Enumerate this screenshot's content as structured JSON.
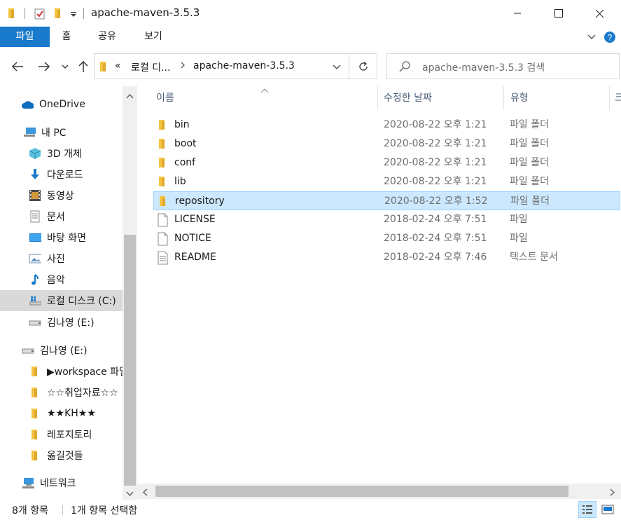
{
  "window": {
    "title": "apache-maven-3.5.3",
    "minimize_symbol": "—",
    "maximize_symbol": "☐",
    "close_symbol": "✕"
  },
  "ribbon": {
    "tabs": [
      "파일",
      "홈",
      "공유",
      "보기"
    ]
  },
  "address": {
    "overflow": "«",
    "segments": [
      "로컬 디...",
      "apache-maven-3.5.3"
    ]
  },
  "search": {
    "placeholder": "apache-maven-3.5.3 검색"
  },
  "nav": {
    "items": [
      {
        "label": "OneDrive",
        "icon": "onedrive-cloud-icon"
      },
      {
        "label": "내 PC",
        "icon": "pc-icon"
      },
      {
        "label": "3D 개체",
        "icon": "3d-objects-icon"
      },
      {
        "label": "다운로드",
        "icon": "download-arrow-icon"
      },
      {
        "label": "동영상",
        "icon": "video-icon"
      },
      {
        "label": "문서",
        "icon": "document-icon"
      },
      {
        "label": "바탕 화면",
        "icon": "desktop-icon"
      },
      {
        "label": "사진",
        "icon": "picture-icon"
      },
      {
        "label": "음악",
        "icon": "music-note-icon"
      },
      {
        "label": "로컬 디스크 (C:)",
        "icon": "local-disk-icon",
        "selected": true
      },
      {
        "label": "김나영 (E:)",
        "icon": "drive-icon"
      },
      {
        "label": "김나영 (E:)",
        "icon": "drive-icon"
      },
      {
        "label": "▶workspace 파일",
        "icon": "folder-icon"
      },
      {
        "label": "☆☆취업자료☆☆",
        "icon": "folder-icon"
      },
      {
        "label": "★★KH★★",
        "icon": "folder-icon"
      },
      {
        "label": "레포지토리",
        "icon": "folder-icon"
      },
      {
        "label": "옮길것들",
        "icon": "folder-icon"
      },
      {
        "label": "네트워크",
        "icon": "network-icon"
      }
    ]
  },
  "columns": {
    "name": "이름",
    "date": "수정한 날짜",
    "type": "유형",
    "size": "크기"
  },
  "files": [
    {
      "name": "bin",
      "date": "2020-08-22 오후 1:21",
      "type": "파일 폴더",
      "icon": "folder-icon"
    },
    {
      "name": "boot",
      "date": "2020-08-22 오후 1:21",
      "type": "파일 폴더",
      "icon": "folder-icon"
    },
    {
      "name": "conf",
      "date": "2020-08-22 오후 1:21",
      "type": "파일 폴더",
      "icon": "folder-icon"
    },
    {
      "name": "lib",
      "date": "2020-08-22 오후 1:21",
      "type": "파일 폴더",
      "icon": "folder-icon"
    },
    {
      "name": "repository",
      "date": "2020-08-22 오후 1:52",
      "type": "파일 폴더",
      "icon": "folder-icon",
      "selected": true
    },
    {
      "name": "LICENSE",
      "date": "2018-02-24 오후 7:51",
      "type": "파일",
      "icon": "blank-file-icon"
    },
    {
      "name": "NOTICE",
      "date": "2018-02-24 오후 7:51",
      "type": "파일",
      "icon": "blank-file-icon"
    },
    {
      "name": "README",
      "date": "2018-02-24 오후 7:46",
      "type": "텍스트 문서",
      "icon": "text-file-icon"
    }
  ],
  "status": {
    "item_count": "8개 항목",
    "selection": "1개 항목 선택함"
  },
  "colors": {
    "file_tab": "#1979ca",
    "selection_bg": "#cce8ff",
    "selection_border": "#99d1ff",
    "folder": "#f5c342"
  }
}
